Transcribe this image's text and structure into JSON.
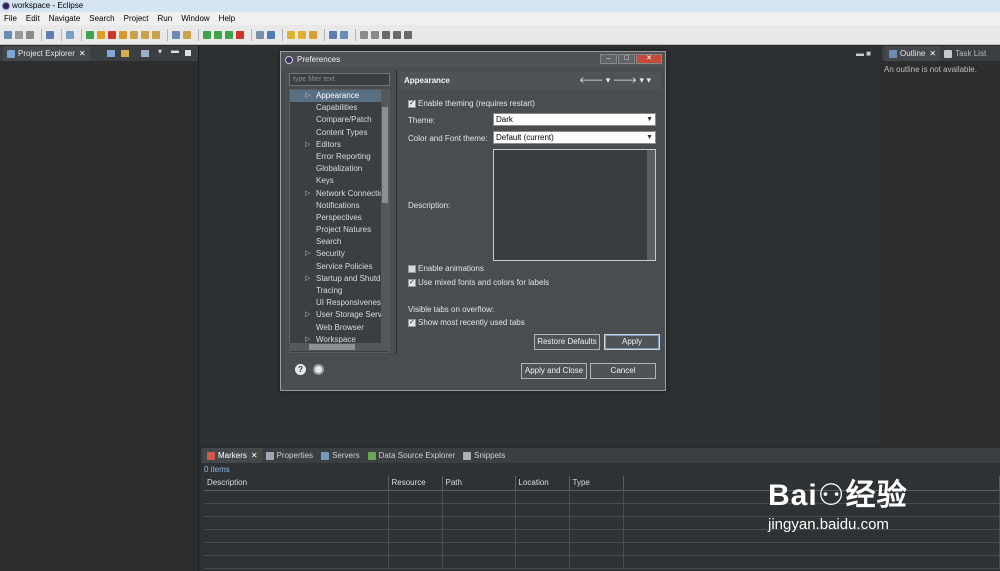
{
  "window": {
    "title": "workspace - Eclipse"
  },
  "menu": [
    "File",
    "Edit",
    "Navigate",
    "Search",
    "Project",
    "Run",
    "Window",
    "Help"
  ],
  "left_view": {
    "tab_label": "Project Explorer"
  },
  "outline_view": {
    "tab_label": "Outline",
    "tab2_label": "Task List",
    "message": "An outline is not available."
  },
  "bottom_view": {
    "tabs": [
      "Markers",
      "Properties",
      "Servers",
      "Data Source Explorer",
      "Snippets"
    ],
    "items_count": "0 items",
    "columns": [
      "Description",
      "Resource",
      "Path",
      "Location",
      "Type"
    ]
  },
  "dialog": {
    "title": "Preferences",
    "filter_placeholder": "type filter text",
    "tree": [
      {
        "label": "Appearance",
        "expandable": true,
        "selected": true
      },
      {
        "label": "Capabilities",
        "expandable": false
      },
      {
        "label": "Compare/Patch",
        "expandable": false
      },
      {
        "label": "Content Types",
        "expandable": false
      },
      {
        "label": "Editors",
        "expandable": true
      },
      {
        "label": "Error Reporting",
        "expandable": false
      },
      {
        "label": "Globalization",
        "expandable": false
      },
      {
        "label": "Keys",
        "expandable": false
      },
      {
        "label": "Network Connectio",
        "expandable": true
      },
      {
        "label": "Notifications",
        "expandable": false
      },
      {
        "label": "Perspectives",
        "expandable": false
      },
      {
        "label": "Project Natures",
        "expandable": false
      },
      {
        "label": "Search",
        "expandable": false
      },
      {
        "label": "Security",
        "expandable": true
      },
      {
        "label": "Service Policies",
        "expandable": false
      },
      {
        "label": "Startup and Shutd",
        "expandable": true
      },
      {
        "label": "Tracing",
        "expandable": false
      },
      {
        "label": "UI Responsiveness",
        "expandable": false
      },
      {
        "label": "User Storage Serv",
        "expandable": true
      },
      {
        "label": "Web Browser",
        "expandable": false
      },
      {
        "label": "Workspace",
        "expandable": true
      }
    ],
    "page_title": "Appearance",
    "enable_theming": "Enable theming (requires restart)",
    "theme_label": "Theme:",
    "theme_value": "Dark",
    "color_font_label": "Color and Font theme:",
    "color_font_value": "Default (current)",
    "description_label": "Description:",
    "enable_animations": "Enable animations",
    "mixed_fonts": "Use mixed fonts and colors for labels",
    "visible_tabs_label": "Visible tabs on overflow:",
    "show_recent_tabs": "Show most recently used tabs",
    "restore_defaults": "Restore Defaults",
    "apply": "Apply",
    "apply_and_close": "Apply and Close",
    "cancel": "Cancel",
    "checks": {
      "enable_theming": true,
      "enable_animations": false,
      "mixed_fonts": true,
      "show_recent_tabs": true
    }
  },
  "watermark": {
    "logo": "Bai⚇经验",
    "url": "jingyan.baidu.com"
  }
}
